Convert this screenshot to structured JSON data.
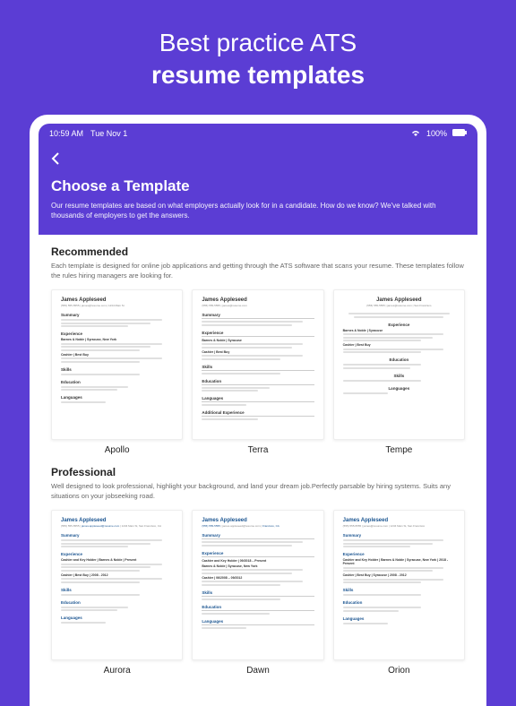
{
  "hero": {
    "line1": "Best practice ATS",
    "line2": "resume templates"
  },
  "statusBar": {
    "time": "10:59 AM",
    "date": "Tue Nov 1",
    "battery": "100%"
  },
  "header": {
    "title": "Choose a Template",
    "description": "Our resume templates are based on what employers actually look for in a candidate. How do we know? We've talked with thousands of employers to get the answers."
  },
  "sections": [
    {
      "title": "Recommended",
      "description": "Each template is designed for online job applications and getting through the ATS software that scans your resume. These templates follow the rules hiring managers are looking for.",
      "templates": [
        {
          "name": "Apollo"
        },
        {
          "name": "Terra"
        },
        {
          "name": "Tempe"
        }
      ]
    },
    {
      "title": "Professional",
      "description": "Well designed to look professional, highlight your background, and land your dream job.Perfectly parsable by hiring systems. Suits any situations on your jobseeking road.",
      "templates": [
        {
          "name": "Aurora"
        },
        {
          "name": "Dawn"
        },
        {
          "name": "Orion"
        }
      ]
    }
  ],
  "preview": {
    "name": "James Appleseed",
    "summaryLabel": "Summary",
    "experienceLabel": "Experience",
    "skillsLabel": "Skills",
    "educationLabel": "Education",
    "languagesLabel": "Languages",
    "additionalLabel": "Additional Experience"
  }
}
